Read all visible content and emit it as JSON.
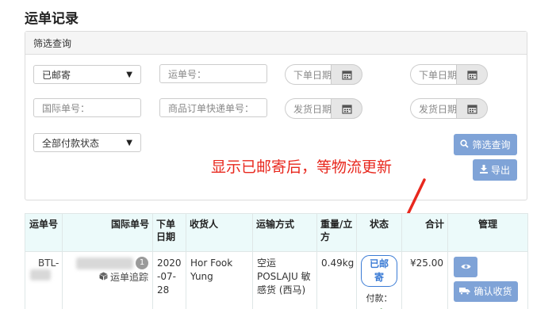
{
  "page": {
    "title": "运单记录"
  },
  "filter": {
    "header": "筛选查询",
    "status_select": "已邮寄",
    "waybill_placeholder": "运单号：",
    "order_date_start": "下单日期",
    "order_date_end": "下单日期",
    "intl_no_placeholder": "国际单号：",
    "product_order_placeholder": "商品订单快递单号：",
    "ship_date_start": "发货日期",
    "ship_date_end": "发货日期",
    "payment_select": "全部付款状态",
    "search_button": "筛选查询",
    "export_button": "导出"
  },
  "annotation": {
    "text": "显示已邮寄后，等物流更新",
    "color": "#e8281e"
  },
  "table": {
    "headers": {
      "waybill": "运单号",
      "intl_no": "国际单号",
      "order_date": "下单日期",
      "recipient": "收货人",
      "ship_method": "运输方式",
      "weight_volume": "重量/立方",
      "status": "状态",
      "total": "合计",
      "manage": "管理"
    },
    "rows": [
      {
        "waybill_prefix": "BTL-",
        "intl_badge": "1",
        "tracking_link": "运单追踪",
        "order_date": "2020-07-28",
        "recipient": "Hor Fook Yung",
        "ship_method": "空运 POSLAJU 敏感货 (西马)",
        "weight": "0.49kg",
        "status": "已邮寄",
        "payment_label": "付款：",
        "total": "¥25.00",
        "confirm_button": "确认收货"
      }
    ]
  },
  "colors": {
    "accent": "#7fa3d7",
    "status": "#3a7bd5",
    "header_bg": "#ecfafa"
  }
}
